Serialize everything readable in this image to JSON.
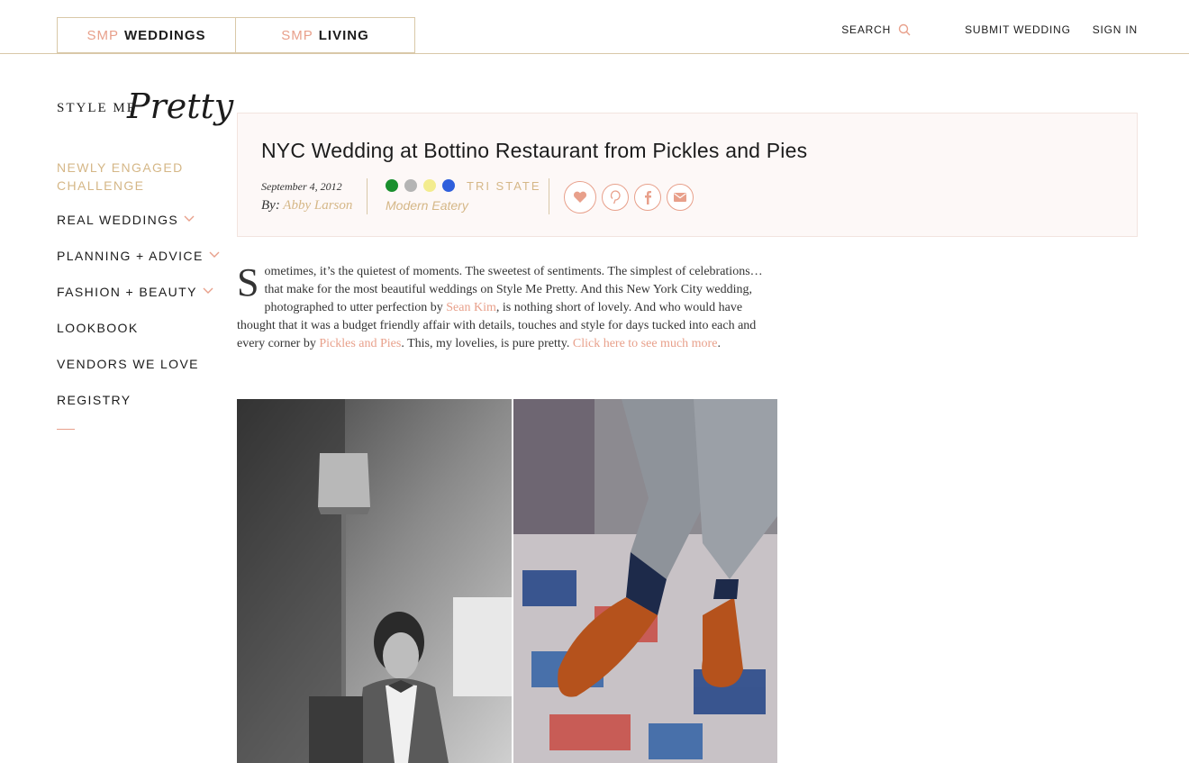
{
  "top_tabs": [
    {
      "prefix": "SMP",
      "label": "WEDDINGS"
    },
    {
      "prefix": "SMP",
      "label": "LIVING"
    }
  ],
  "top_nav": {
    "search": "SEARCH",
    "submit": "SUBMIT WEDDING",
    "signin": "SIGN IN"
  },
  "logo": {
    "small": "STYLE ME",
    "script": "Pretty"
  },
  "sidebar": {
    "items": [
      {
        "label": "NEWLY ENGAGED CHALLENGE"
      },
      {
        "label": "REAL WEDDINGS"
      },
      {
        "label": "PLANNING + ADVICE"
      },
      {
        "label": "FASHION + BEAUTY"
      },
      {
        "label": "LOOKBOOK"
      },
      {
        "label": "VENDORS WE LOVE"
      },
      {
        "label": "REGISTRY"
      }
    ]
  },
  "article": {
    "title": "NYC Wedding at Bottino Restaurant from Pickles and Pies",
    "date": "September 4, 2012",
    "by_prefix": "By: ",
    "author": "Abby Larson",
    "region": "TRI STATE",
    "venue": "Modern Eatery",
    "palette": [
      "#1a8f2e",
      "#b4b4b4",
      "#f3ec8e",
      "#2f5fdc"
    ],
    "body": {
      "dropcap": "S",
      "p1": "ometimes, it’s the quietest of moments. The sweetest of sentiments. The simplest of celebrations…that make for the most beautiful weddings on Style Me Pretty. And this New York City wedding, photographed to utter perfection by ",
      "link1": "Sean Kim",
      "p2": ", is nothing short of lovely. And who would have thought that it was a budget friendly affair with details, touches and style for days tucked into each and every corner by ",
      "link2": "Pickles and Pies",
      "p3": ". This, my lovelies, is pure pretty. ",
      "link3": "Click here to see much more",
      "p4": "."
    }
  },
  "colors": {
    "accent": "#e8a08b",
    "gold": "#d5b787",
    "border": "#d9c8a8"
  }
}
